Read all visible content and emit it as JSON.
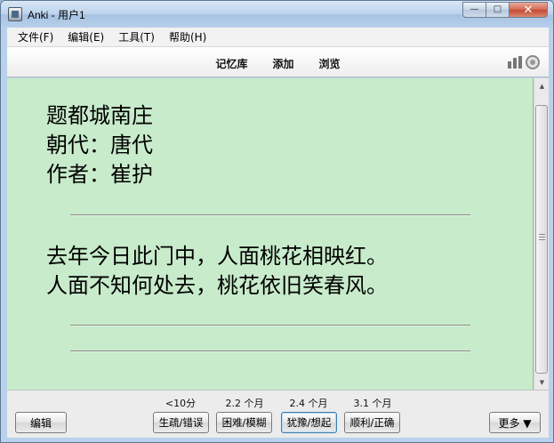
{
  "window": {
    "title": "Anki - 用户1",
    "min_symbol": "—",
    "max_symbol": "□",
    "close_symbol": "✕"
  },
  "menu": {
    "items": [
      "文件(F)",
      "编辑(E)",
      "工具(T)",
      "帮助(H)"
    ]
  },
  "toolbar": {
    "decks": "记忆库",
    "add": "添加",
    "browse": "浏览"
  },
  "card": {
    "front": [
      "题都城南庄",
      "朝代：唐代",
      "作者：崔护"
    ],
    "back": [
      "去年今日此门中，人面桃花相映红。",
      "人面不知何处去，桃花依旧笑春风。"
    ]
  },
  "bottom": {
    "edit_label": "编辑",
    "more_label": "更多 ▼",
    "ease": [
      {
        "interval": "<10分",
        "label": "生疏/错误"
      },
      {
        "interval": "2.2 个月",
        "label": "困难/模糊"
      },
      {
        "interval": "2.4 个月",
        "label": "犹豫/想起"
      },
      {
        "interval": "3.1 个月",
        "label": "顺利/正确"
      }
    ]
  },
  "colors": {
    "card_background": "#c8ebcb",
    "focus_border": "#3c7fb1"
  },
  "icons": {
    "app": "anki-app-icon",
    "stats": "stats-icon",
    "sync": "sync-icon"
  }
}
